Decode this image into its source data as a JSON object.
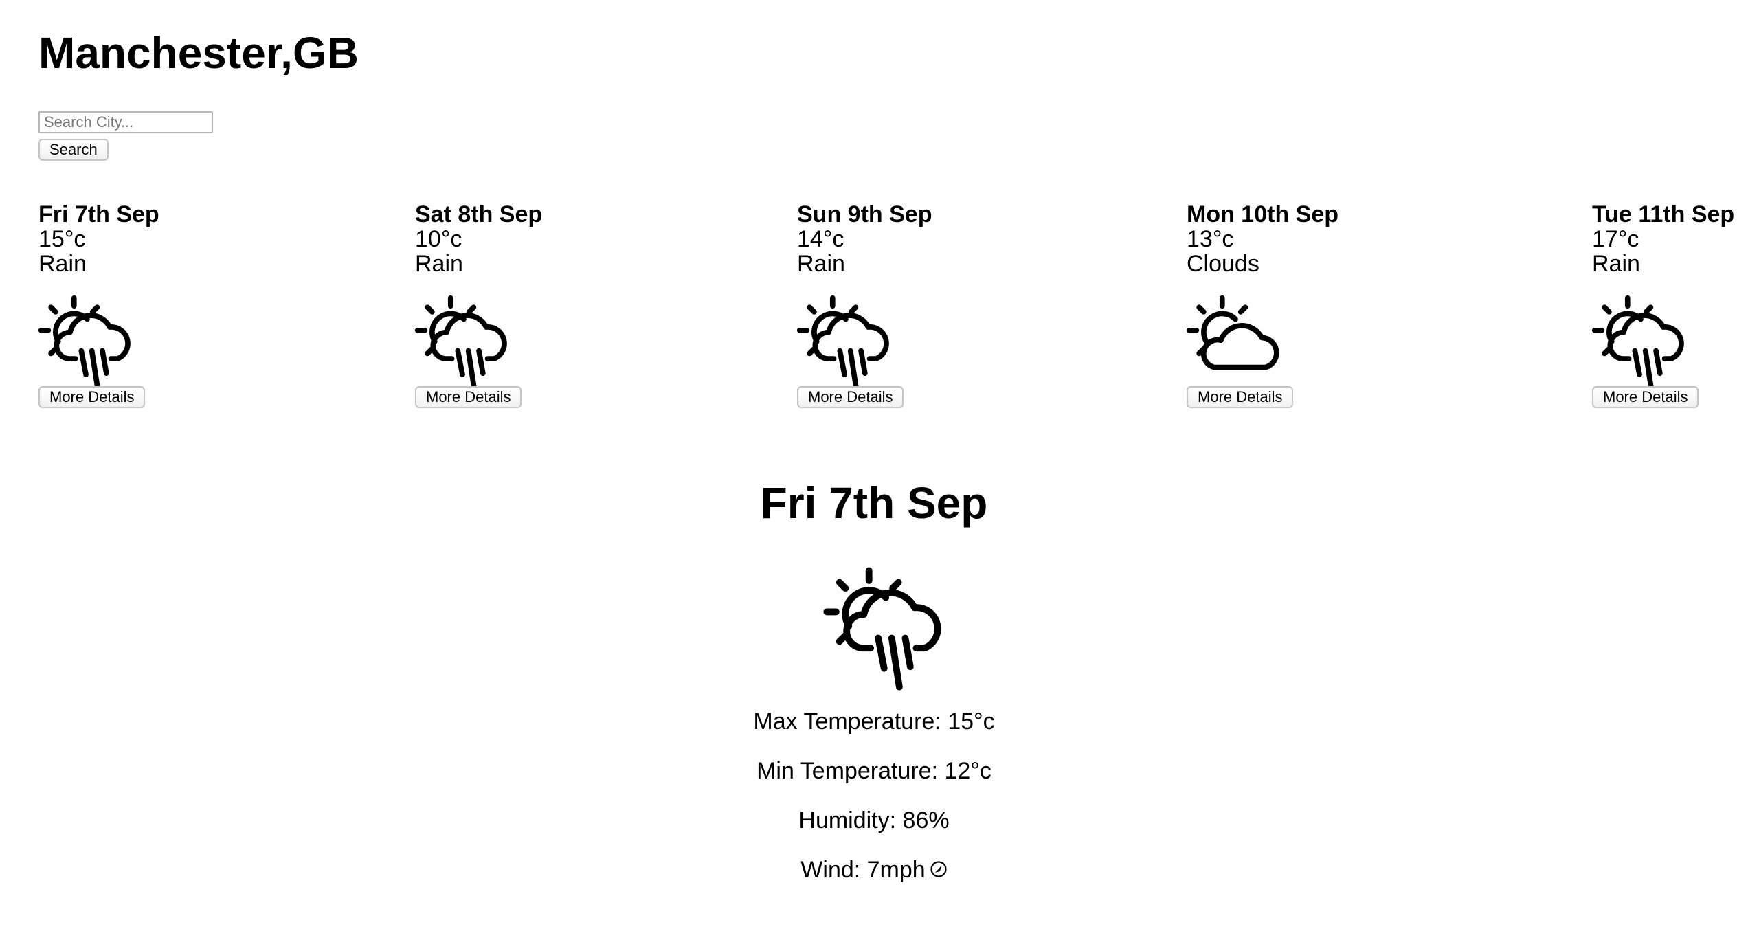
{
  "location": {
    "title": "Manchester,GB"
  },
  "search": {
    "placeholder": "Search City...",
    "value": "",
    "button_label": "Search"
  },
  "forecast": [
    {
      "day": "Fri 7th Sep",
      "temp": "15°c",
      "condition": "Rain",
      "icon": "sun-cloud-rain-icon",
      "button_label": "More Details"
    },
    {
      "day": "Sat 8th Sep",
      "temp": "10°c",
      "condition": "Rain",
      "icon": "sun-cloud-rain-icon",
      "button_label": "More Details"
    },
    {
      "day": "Sun 9th Sep",
      "temp": "14°c",
      "condition": "Rain",
      "icon": "sun-cloud-rain-icon",
      "button_label": "More Details"
    },
    {
      "day": "Mon 10th Sep",
      "temp": "13°c",
      "condition": "Clouds",
      "icon": "sun-cloud-icon",
      "button_label": "More Details"
    },
    {
      "day": "Tue 11th Sep",
      "temp": "17°c",
      "condition": "Rain",
      "icon": "sun-cloud-rain-icon",
      "button_label": "More Details"
    }
  ],
  "details": {
    "title": "Fri 7th Sep",
    "icon": "sun-cloud-rain-icon",
    "max_temp": "Max Temperature: 15°c",
    "min_temp": "Min Temperature: 12°c",
    "humidity": "Humidity: 86%",
    "wind": "Wind: 7mph",
    "wind_icon": "wind-direction-icon"
  }
}
